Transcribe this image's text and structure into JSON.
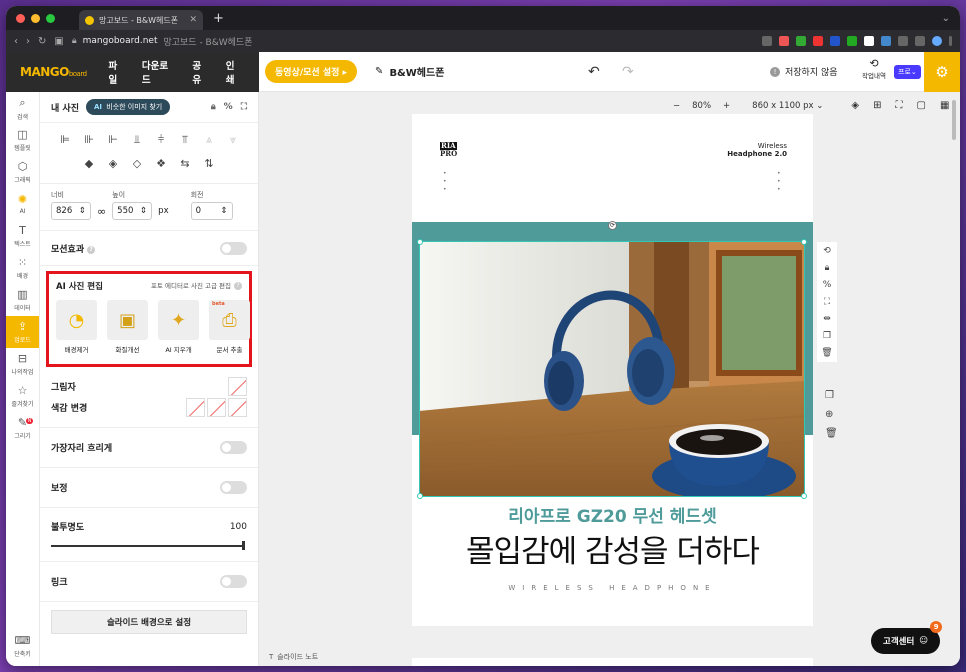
{
  "browser": {
    "tab_title": "망고보드 - B&W헤드폰",
    "url_host": "mangoboard.net",
    "url_title": "망고보드 - B&W헤드폰",
    "new_tab": "+"
  },
  "header": {
    "logo_main": "MANGO",
    "logo_sub": "board",
    "menu": [
      "파일",
      "다운로드",
      "공유",
      "인쇄"
    ],
    "motion_button": "동영상/모션 설정 ▸",
    "doc_title": "B&W헤드폰",
    "save_status": "저장하지 않음",
    "history_label": "작업내역",
    "pro_badge": "프로⌄"
  },
  "rail": [
    {
      "label": "검색",
      "icon": "⌕"
    },
    {
      "label": "템플릿",
      "icon": "◫"
    },
    {
      "label": "그래픽",
      "icon": "⬡"
    },
    {
      "label": "AI",
      "icon": "✺"
    },
    {
      "label": "텍스트",
      "icon": "T"
    },
    {
      "label": "배경",
      "icon": "⁙"
    },
    {
      "label": "데이터",
      "icon": "▥"
    },
    {
      "label": "업로드",
      "icon": "⇪"
    },
    {
      "label": "나의작업",
      "icon": "⊟"
    },
    {
      "label": "즐겨찾기",
      "icon": "☆"
    },
    {
      "label": "그리기",
      "icon": "✎"
    }
  ],
  "rail_bottom": {
    "label": "단축키",
    "icon": "⌨"
  },
  "rail_new_badge": "N",
  "panel": {
    "title": "내 사진",
    "ai_pill_prefix": "AI",
    "ai_pill_label": "비슷한 이미지 찾기",
    "width_label": "너비",
    "width_value": "826",
    "height_label": "높이",
    "height_value": "550",
    "unit": "px",
    "rotation_label": "회전",
    "rotation_value": "0",
    "motion_effect": "모션효과",
    "ai_edit_title": "AI 사진 편집",
    "ai_edit_link": "포토 에디터로 사진 고급 편집",
    "ai_tools": [
      {
        "label": "배경제거",
        "icon": "◔"
      },
      {
        "label": "화질개선",
        "icon": "▣"
      },
      {
        "label": "AI 지우개",
        "icon": "✦"
      },
      {
        "label": "문서 추출",
        "icon": "⎙",
        "badge": "beta"
      }
    ],
    "shadow": "그림자",
    "color_change": "색감 변경",
    "edge_blur": "가장자리 흐리게",
    "correction": "보정",
    "opacity": "불투명도",
    "opacity_value": "100",
    "opacity_fraction": 1.0,
    "link": "링크",
    "set_bg_button": "슬라이드 배경으로 설정"
  },
  "canvas": {
    "zoom_minus": "−",
    "zoom": "80%",
    "zoom_plus": "+",
    "page_size": "860 x 1100 px ⌄",
    "brand_line1": "RIA",
    "brand_line2": "PRO",
    "tag_line1": "Wireless",
    "tag_line2": "Headphone 2.0",
    "headline_sub": "리아프로 GZ20 무선 헤드셋",
    "headline_main": "몰입감에 감성을 더하다",
    "spaced_text": "WIRELESS HEADPHONE",
    "slide_note": "슬라이드 노트",
    "support_button": "고객센터",
    "support_badge": "9"
  },
  "colors": {
    "mango_yellow": "#f5b800",
    "teal": "#4e9b9a",
    "highlight_red": "#e3141b",
    "selection": "#31c7b5",
    "pro_purple": "#4a3aff"
  }
}
